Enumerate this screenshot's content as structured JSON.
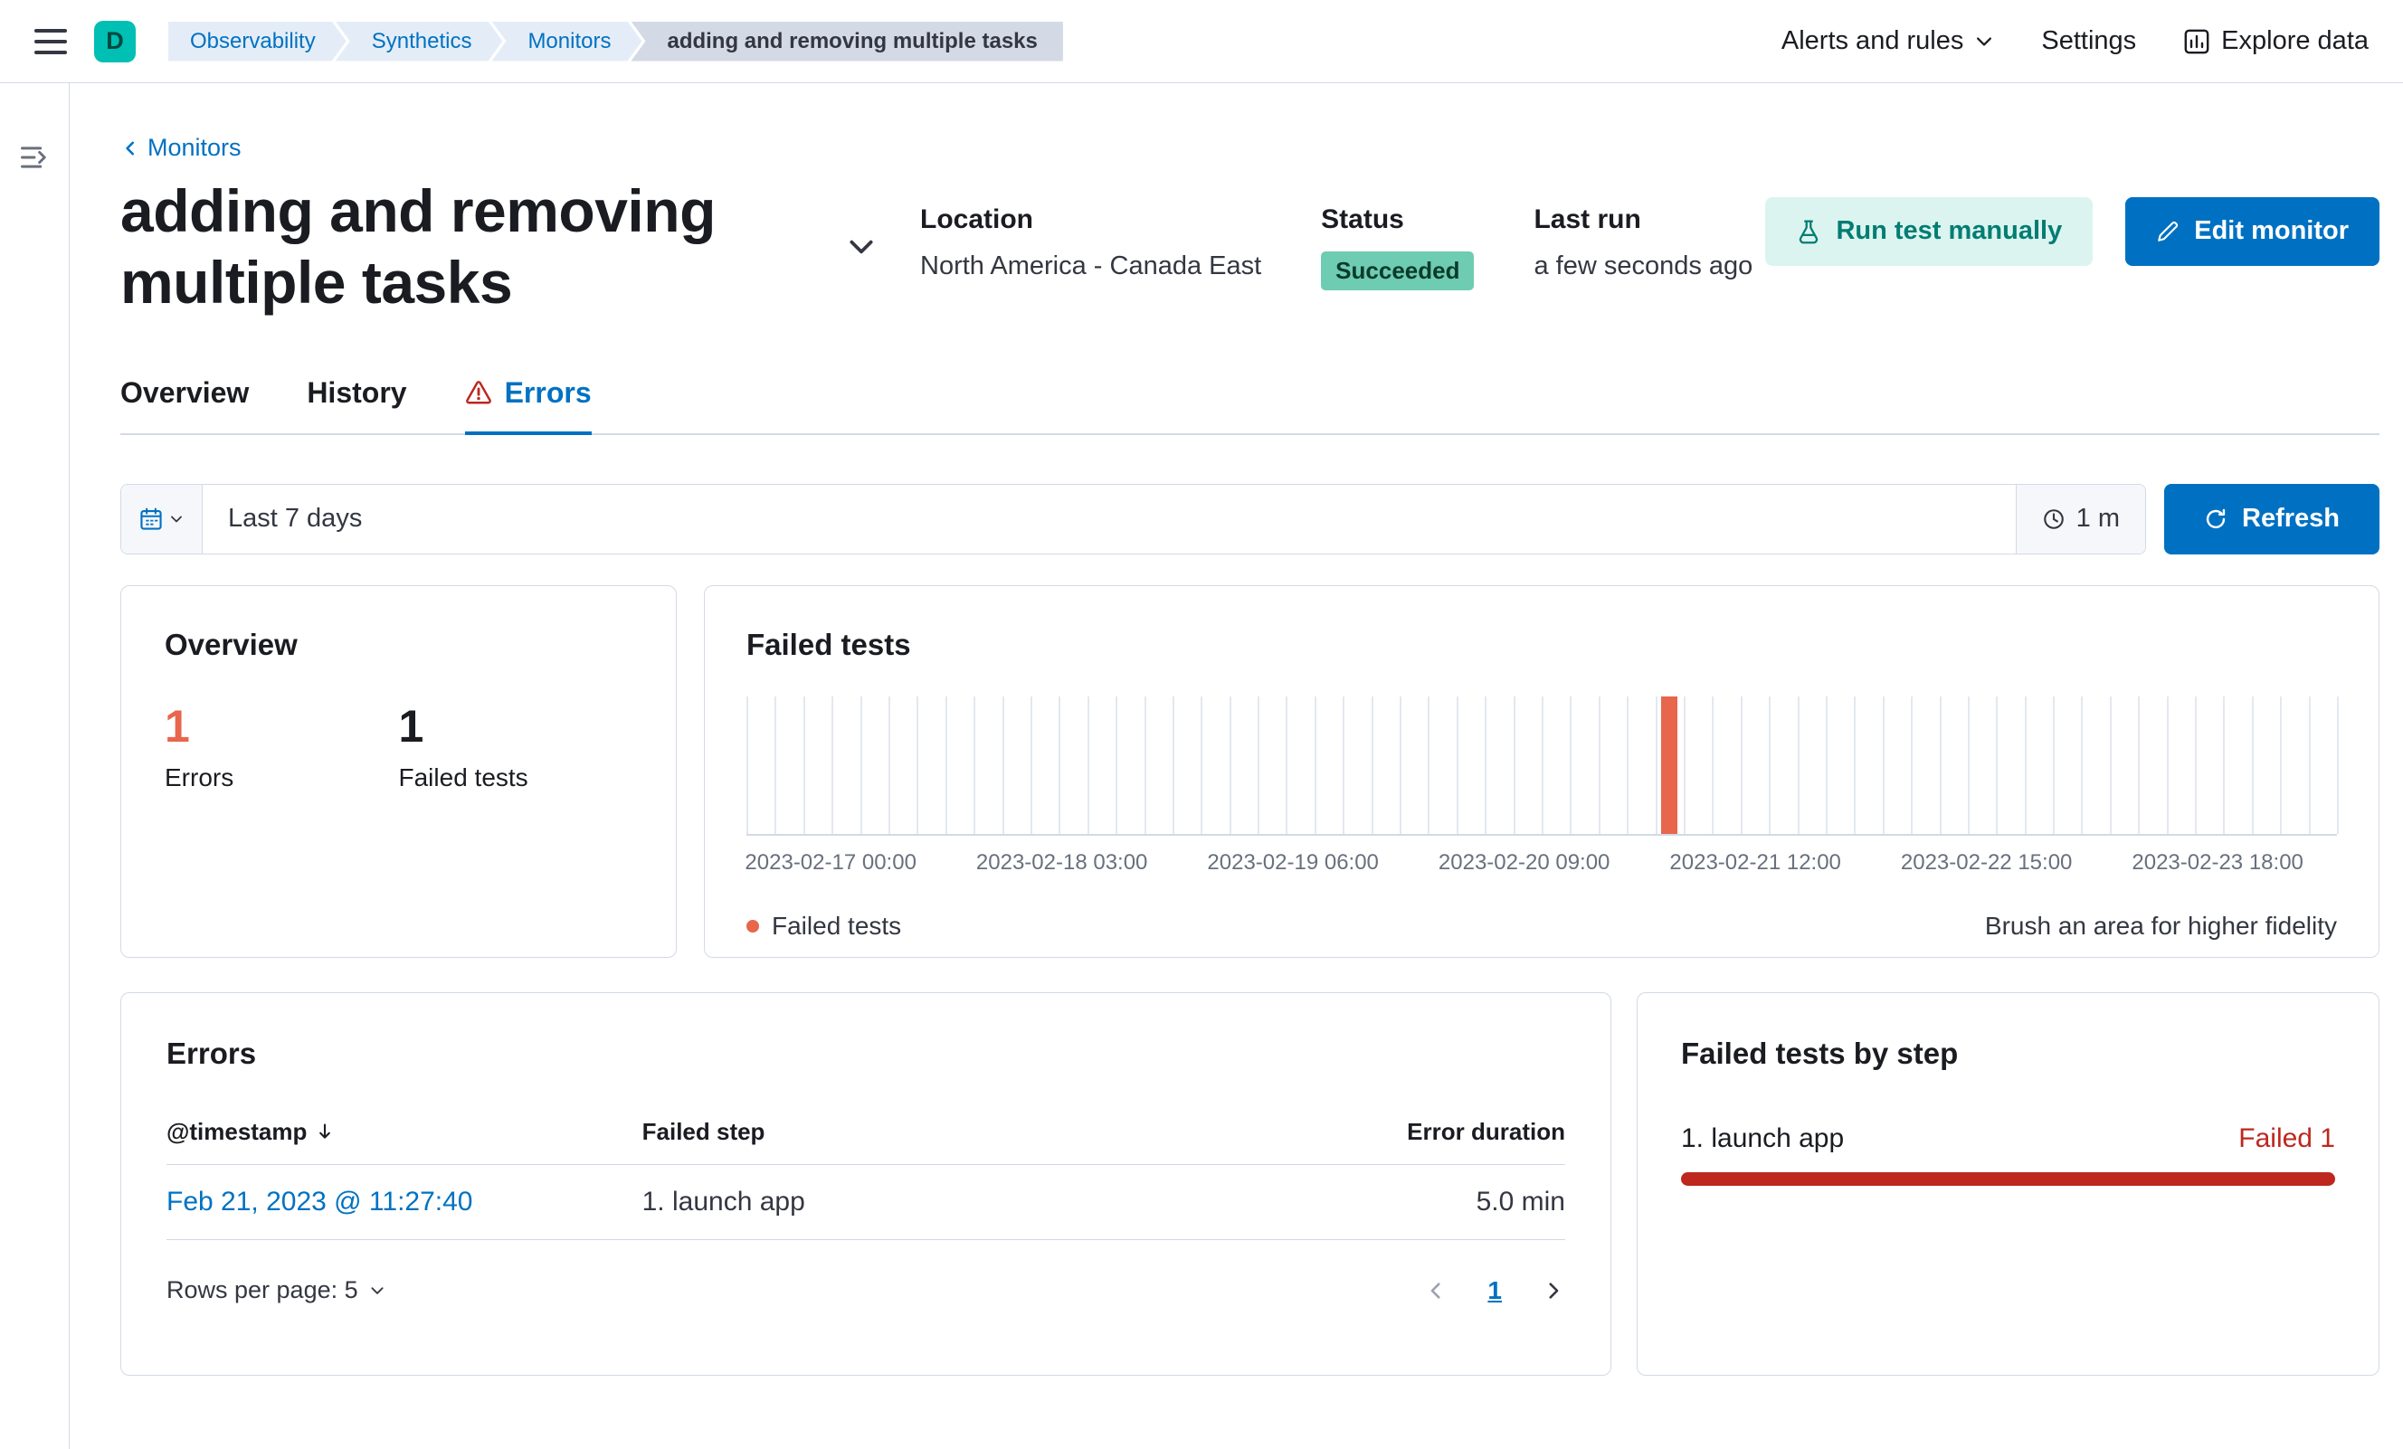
{
  "colors": {
    "primary": "#0071C2",
    "danger": "#BD271E",
    "vis_red": "#E7664C",
    "success_badge": "#6DCCB1",
    "brand_teal": "#00BFB3"
  },
  "header": {
    "logo_initial": "D",
    "breadcrumbs": [
      "Observability",
      "Synthetics",
      "Monitors",
      "adding and removing multiple tasks"
    ],
    "alerts_menu": "Alerts and rules",
    "settings_label": "Settings",
    "explore_data_label": "Explore data"
  },
  "page": {
    "back_link": "Monitors",
    "title": "adding and removing multiple tasks",
    "location_label": "Location",
    "location_value": "North America - Canada East",
    "status_label": "Status",
    "status_value": "Succeeded",
    "last_run_label": "Last run",
    "last_run_value": "a few seconds ago",
    "run_test_button": "Run test manually",
    "edit_monitor_button": "Edit monitor",
    "tabs": [
      {
        "label": "Overview",
        "active": false
      },
      {
        "label": "History",
        "active": false
      },
      {
        "label": "Errors",
        "active": true
      }
    ]
  },
  "datepicker": {
    "range_label": "Last 7 days",
    "refresh_interval": "1 m",
    "refresh_button": "Refresh"
  },
  "overview_panel": {
    "title": "Overview",
    "stats": [
      {
        "value": "1",
        "label": "Errors",
        "color": "#E7664C"
      },
      {
        "value": "1",
        "label": "Failed tests",
        "color": "#1A1C21"
      }
    ]
  },
  "chart_data": {
    "type": "bar",
    "title": "Failed tests",
    "bins": 56,
    "bin_duration_hours": 3,
    "x_tick_labels": [
      "2023-02-17 00:00",
      "2023-02-18 03:00",
      "2023-02-19 06:00",
      "2023-02-20 09:00",
      "2023-02-21 12:00",
      "2023-02-22 15:00",
      "2023-02-23 18:00"
    ],
    "ylim": [
      0,
      1
    ],
    "grid": "vertical",
    "series": [
      {
        "name": "Failed tests",
        "color": "#E7664C",
        "points": [
          {
            "bin_index": 32,
            "approx_time": "2023-02-21",
            "count": 1
          }
        ]
      }
    ],
    "legend": {
      "position": "bottom-left",
      "items": [
        {
          "label": "Failed tests",
          "color": "#E7664C"
        }
      ]
    },
    "hint": "Brush an area for higher fidelity"
  },
  "errors_panel": {
    "title": "Errors",
    "columns": [
      "@timestamp",
      "Failed step",
      "Error duration"
    ],
    "sorted_column": "@timestamp",
    "sort_direction": "desc",
    "rows": [
      {
        "timestamp": "Feb 21, 2023 @ 11:27:40",
        "failed_step": "1. launch app",
        "error_duration": "5.0 min"
      }
    ],
    "rows_per_page": "Rows per page: 5",
    "current_page": "1"
  },
  "failed_steps_panel": {
    "title": "Failed tests by step",
    "steps": [
      {
        "name": "1. launch app",
        "status": "Failed 1",
        "value": 1,
        "max": 1,
        "color": "#BD271E"
      }
    ]
  },
  "icons": {
    "menu-icon": "hamburger",
    "nav-expand-icon": "lines-with-right-arrow",
    "chevron-down-icon": "chevron-down",
    "chevron-left-icon": "chevron-left",
    "explore-data-icon": "bar-chart-in-box",
    "beaker-icon": "lab-beaker",
    "pencil-icon": "pencil",
    "warning-icon": "red-triangle-exclamation",
    "calendar-icon": "calendar",
    "refresh-interval-icon": "clock",
    "refresh-icon": "circular-arrow",
    "sort-desc-icon": "arrow-down",
    "legend-dot": "colored-circle"
  }
}
